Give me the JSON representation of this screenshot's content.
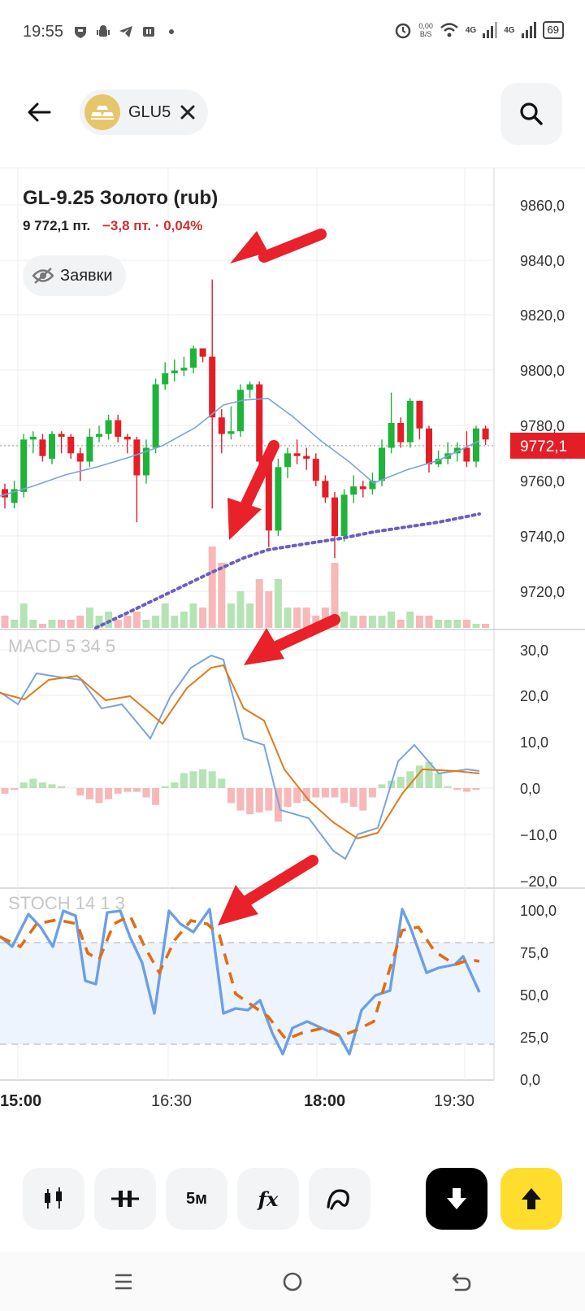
{
  "status": {
    "time": "19:55",
    "net_speed_value": "0,00",
    "net_speed_unit": "B/S",
    "net1": "4G",
    "net2": "4G",
    "battery": "69"
  },
  "header": {
    "ticker": "GLU5",
    "instrument": "GL-9.25  Золото (rub)",
    "price": "9 772,1 пт.",
    "change": "−3,8 пт. · 0,04%",
    "orders_label": "Заявки"
  },
  "chart": {
    "price_ticks": [
      "9860,0",
      "9840,0",
      "9820,0",
      "9800,0",
      "9780,0",
      "9760,0",
      "9740,0",
      "9720,0"
    ],
    "current_price_tag": "9772,1",
    "macd_label": "MACD 5 34 5",
    "macd_ticks": [
      "30,0",
      "20,0",
      "10,0",
      "0,0",
      "−10,0",
      "−20,0"
    ],
    "stoch_label": "STOCH 14 1 3",
    "stoch_ticks": [
      "100,0",
      "75,0",
      "50,0",
      "25,0",
      "0,0"
    ],
    "time_ticks": [
      "15:00",
      "16:30",
      "18:00",
      "19:30"
    ],
    "colors": {
      "up": "#1fb33a",
      "down": "#e31e26",
      "ma_line": "#7ba4db",
      "ma_dotted": "#6a5fc0",
      "macd_line": "#7ba4db",
      "macd_signal": "#e07b1a",
      "hist_pos": "#b6e3b6",
      "hist_neg": "#f6b8b8",
      "stoch_k": "#6c9fe6",
      "stoch_d": "#e36d12",
      "price_tag": "#e31e26",
      "annotation": "#e8212a"
    }
  },
  "toolbar": {
    "interval_label": "5м",
    "indicator_label": "fx"
  },
  "icons": {
    "back": "arrow-left-icon",
    "close": "close-icon",
    "search": "search-icon",
    "eye_off": "eye-off-icon",
    "candles": "candlestick-icon",
    "compare": "compare-icon",
    "draw": "draw-icon",
    "sell": "arrow-down-icon",
    "buy": "arrow-up-icon"
  }
}
